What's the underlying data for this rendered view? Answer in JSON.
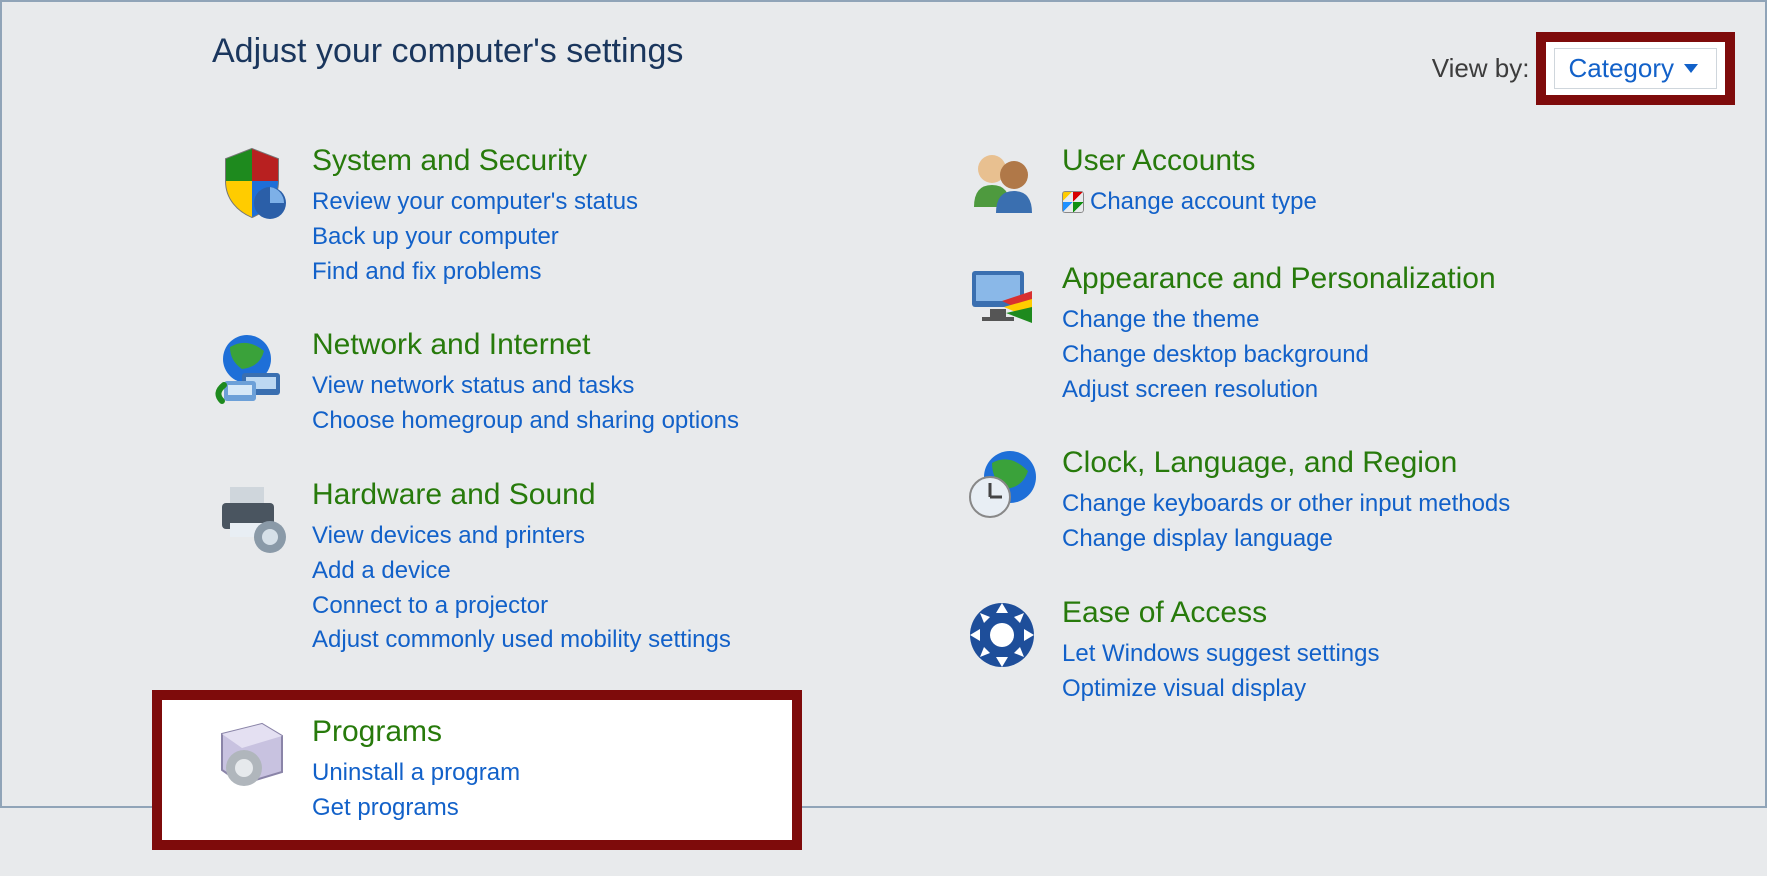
{
  "page_title": "Adjust your computer's settings",
  "viewby_label": "View by:",
  "viewby_value": "Category",
  "left": [
    {
      "title": "System and Security",
      "links": [
        "Review your computer's status",
        "Back up your computer",
        "Find and fix problems"
      ]
    },
    {
      "title": "Network and Internet",
      "links": [
        "View network status and tasks",
        "Choose homegroup and sharing options"
      ]
    },
    {
      "title": "Hardware and Sound",
      "links": [
        "View devices and printers",
        "Add a device",
        "Connect to a projector",
        "Adjust commonly used mobility settings"
      ]
    },
    {
      "title": "Programs",
      "links": [
        "Uninstall a program",
        "Get programs"
      ]
    }
  ],
  "right": [
    {
      "title": "User Accounts",
      "links": [
        "Change account type"
      ],
      "uac": [
        true
      ]
    },
    {
      "title": "Appearance and Personalization",
      "links": [
        "Change the theme",
        "Change desktop background",
        "Adjust screen resolution"
      ]
    },
    {
      "title": "Clock, Language, and Region",
      "links": [
        "Change keyboards or other input methods",
        "Change display language"
      ]
    },
    {
      "title": "Ease of Access",
      "links": [
        "Let Windows suggest settings",
        "Optimize visual display"
      ]
    }
  ]
}
